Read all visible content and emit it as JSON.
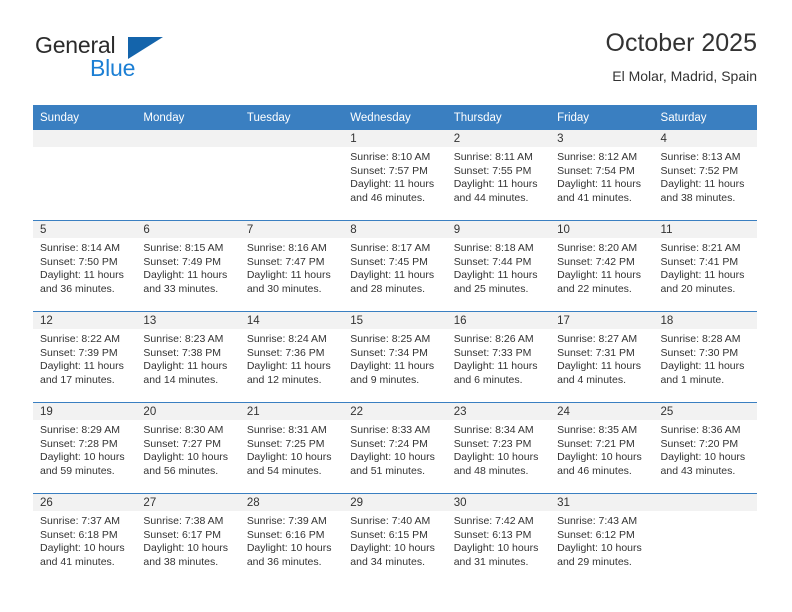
{
  "brand": {
    "name_part1": "General",
    "name_part2": "Blue",
    "triangle_color": "#1464ab",
    "blue_text_color": "#1c7fd4"
  },
  "header": {
    "title": "October 2025",
    "subtitle": "El Molar, Madrid, Spain"
  },
  "theme": {
    "header_blue": "#3a7fc1",
    "daynum_band": "#f2f2f2",
    "text": "#333333"
  },
  "weekday_headers": [
    "Sunday",
    "Monday",
    "Tuesday",
    "Wednesday",
    "Thursday",
    "Friday",
    "Saturday"
  ],
  "labels": {
    "sunrise_prefix": "Sunrise:",
    "sunset_prefix": "Sunset:",
    "daylight_prefix": "Daylight:"
  },
  "weeks": [
    [
      {
        "day": "",
        "empty": true
      },
      {
        "day": "",
        "empty": true
      },
      {
        "day": "",
        "empty": true
      },
      {
        "day": "1",
        "sunrise": "Sunrise: 8:10 AM",
        "sunset": "Sunset: 7:57 PM",
        "daylight_line1": "Daylight: 11 hours",
        "daylight_line2": "and 46 minutes."
      },
      {
        "day": "2",
        "sunrise": "Sunrise: 8:11 AM",
        "sunset": "Sunset: 7:55 PM",
        "daylight_line1": "Daylight: 11 hours",
        "daylight_line2": "and 44 minutes."
      },
      {
        "day": "3",
        "sunrise": "Sunrise: 8:12 AM",
        "sunset": "Sunset: 7:54 PM",
        "daylight_line1": "Daylight: 11 hours",
        "daylight_line2": "and 41 minutes."
      },
      {
        "day": "4",
        "sunrise": "Sunrise: 8:13 AM",
        "sunset": "Sunset: 7:52 PM",
        "daylight_line1": "Daylight: 11 hours",
        "daylight_line2": "and 38 minutes."
      }
    ],
    [
      {
        "day": "5",
        "sunrise": "Sunrise: 8:14 AM",
        "sunset": "Sunset: 7:50 PM",
        "daylight_line1": "Daylight: 11 hours",
        "daylight_line2": "and 36 minutes."
      },
      {
        "day": "6",
        "sunrise": "Sunrise: 8:15 AM",
        "sunset": "Sunset: 7:49 PM",
        "daylight_line1": "Daylight: 11 hours",
        "daylight_line2": "and 33 minutes."
      },
      {
        "day": "7",
        "sunrise": "Sunrise: 8:16 AM",
        "sunset": "Sunset: 7:47 PM",
        "daylight_line1": "Daylight: 11 hours",
        "daylight_line2": "and 30 minutes."
      },
      {
        "day": "8",
        "sunrise": "Sunrise: 8:17 AM",
        "sunset": "Sunset: 7:45 PM",
        "daylight_line1": "Daylight: 11 hours",
        "daylight_line2": "and 28 minutes."
      },
      {
        "day": "9",
        "sunrise": "Sunrise: 8:18 AM",
        "sunset": "Sunset: 7:44 PM",
        "daylight_line1": "Daylight: 11 hours",
        "daylight_line2": "and 25 minutes."
      },
      {
        "day": "10",
        "sunrise": "Sunrise: 8:20 AM",
        "sunset": "Sunset: 7:42 PM",
        "daylight_line1": "Daylight: 11 hours",
        "daylight_line2": "and 22 minutes."
      },
      {
        "day": "11",
        "sunrise": "Sunrise: 8:21 AM",
        "sunset": "Sunset: 7:41 PM",
        "daylight_line1": "Daylight: 11 hours",
        "daylight_line2": "and 20 minutes."
      }
    ],
    [
      {
        "day": "12",
        "sunrise": "Sunrise: 8:22 AM",
        "sunset": "Sunset: 7:39 PM",
        "daylight_line1": "Daylight: 11 hours",
        "daylight_line2": "and 17 minutes."
      },
      {
        "day": "13",
        "sunrise": "Sunrise: 8:23 AM",
        "sunset": "Sunset: 7:38 PM",
        "daylight_line1": "Daylight: 11 hours",
        "daylight_line2": "and 14 minutes."
      },
      {
        "day": "14",
        "sunrise": "Sunrise: 8:24 AM",
        "sunset": "Sunset: 7:36 PM",
        "daylight_line1": "Daylight: 11 hours",
        "daylight_line2": "and 12 minutes."
      },
      {
        "day": "15",
        "sunrise": "Sunrise: 8:25 AM",
        "sunset": "Sunset: 7:34 PM",
        "daylight_line1": "Daylight: 11 hours",
        "daylight_line2": "and 9 minutes."
      },
      {
        "day": "16",
        "sunrise": "Sunrise: 8:26 AM",
        "sunset": "Sunset: 7:33 PM",
        "daylight_line1": "Daylight: 11 hours",
        "daylight_line2": "and 6 minutes."
      },
      {
        "day": "17",
        "sunrise": "Sunrise: 8:27 AM",
        "sunset": "Sunset: 7:31 PM",
        "daylight_line1": "Daylight: 11 hours",
        "daylight_line2": "and 4 minutes."
      },
      {
        "day": "18",
        "sunrise": "Sunrise: 8:28 AM",
        "sunset": "Sunset: 7:30 PM",
        "daylight_line1": "Daylight: 11 hours",
        "daylight_line2": "and 1 minute."
      }
    ],
    [
      {
        "day": "19",
        "sunrise": "Sunrise: 8:29 AM",
        "sunset": "Sunset: 7:28 PM",
        "daylight_line1": "Daylight: 10 hours",
        "daylight_line2": "and 59 minutes."
      },
      {
        "day": "20",
        "sunrise": "Sunrise: 8:30 AM",
        "sunset": "Sunset: 7:27 PM",
        "daylight_line1": "Daylight: 10 hours",
        "daylight_line2": "and 56 minutes."
      },
      {
        "day": "21",
        "sunrise": "Sunrise: 8:31 AM",
        "sunset": "Sunset: 7:25 PM",
        "daylight_line1": "Daylight: 10 hours",
        "daylight_line2": "and 54 minutes."
      },
      {
        "day": "22",
        "sunrise": "Sunrise: 8:33 AM",
        "sunset": "Sunset: 7:24 PM",
        "daylight_line1": "Daylight: 10 hours",
        "daylight_line2": "and 51 minutes."
      },
      {
        "day": "23",
        "sunrise": "Sunrise: 8:34 AM",
        "sunset": "Sunset: 7:23 PM",
        "daylight_line1": "Daylight: 10 hours",
        "daylight_line2": "and 48 minutes."
      },
      {
        "day": "24",
        "sunrise": "Sunrise: 8:35 AM",
        "sunset": "Sunset: 7:21 PM",
        "daylight_line1": "Daylight: 10 hours",
        "daylight_line2": "and 46 minutes."
      },
      {
        "day": "25",
        "sunrise": "Sunrise: 8:36 AM",
        "sunset": "Sunset: 7:20 PM",
        "daylight_line1": "Daylight: 10 hours",
        "daylight_line2": "and 43 minutes."
      }
    ],
    [
      {
        "day": "26",
        "sunrise": "Sunrise: 7:37 AM",
        "sunset": "Sunset: 6:18 PM",
        "daylight_line1": "Daylight: 10 hours",
        "daylight_line2": "and 41 minutes."
      },
      {
        "day": "27",
        "sunrise": "Sunrise: 7:38 AM",
        "sunset": "Sunset: 6:17 PM",
        "daylight_line1": "Daylight: 10 hours",
        "daylight_line2": "and 38 minutes."
      },
      {
        "day": "28",
        "sunrise": "Sunrise: 7:39 AM",
        "sunset": "Sunset: 6:16 PM",
        "daylight_line1": "Daylight: 10 hours",
        "daylight_line2": "and 36 minutes."
      },
      {
        "day": "29",
        "sunrise": "Sunrise: 7:40 AM",
        "sunset": "Sunset: 6:15 PM",
        "daylight_line1": "Daylight: 10 hours",
        "daylight_line2": "and 34 minutes."
      },
      {
        "day": "30",
        "sunrise": "Sunrise: 7:42 AM",
        "sunset": "Sunset: 6:13 PM",
        "daylight_line1": "Daylight: 10 hours",
        "daylight_line2": "and 31 minutes."
      },
      {
        "day": "31",
        "sunrise": "Sunrise: 7:43 AM",
        "sunset": "Sunset: 6:12 PM",
        "daylight_line1": "Daylight: 10 hours",
        "daylight_line2": "and 29 minutes."
      },
      {
        "day": "",
        "empty": true
      }
    ]
  ]
}
